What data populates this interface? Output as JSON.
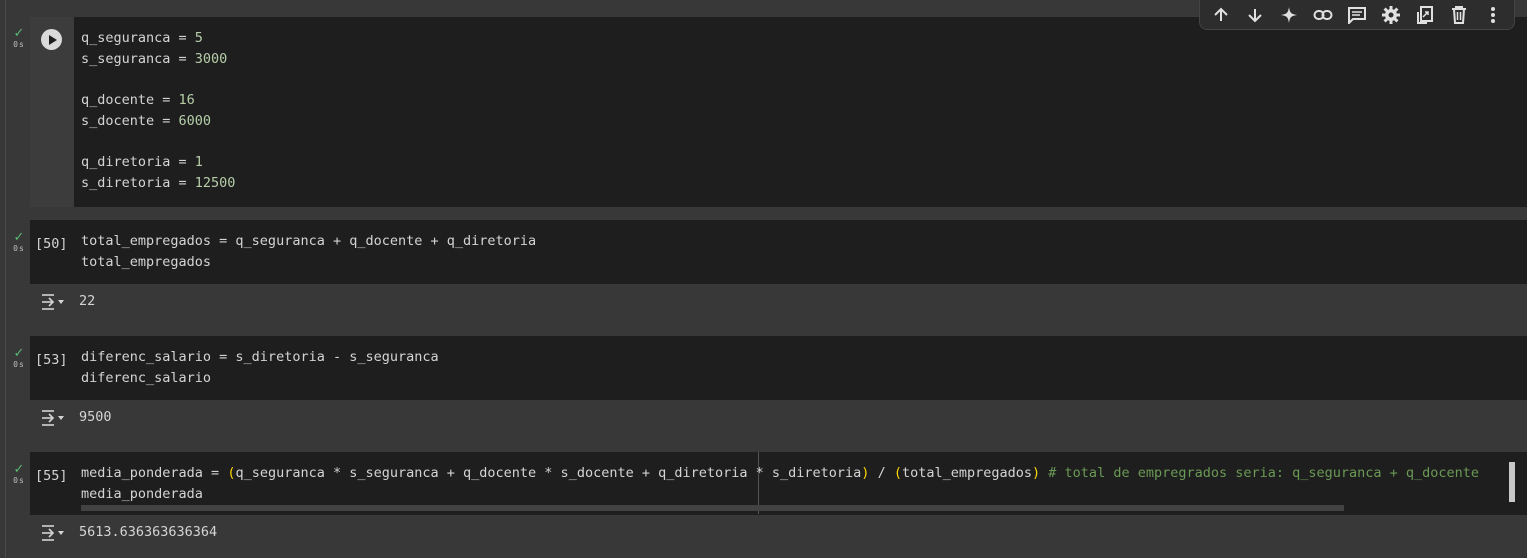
{
  "toolbar": {
    "icons": [
      "arrow-up-icon",
      "arrow-down-icon",
      "sparkle-icon",
      "link-icon",
      "comment-icon",
      "gear-icon",
      "mirror-cell-icon",
      "trash-icon",
      "more-vert-icon"
    ]
  },
  "cells": [
    {
      "status": {
        "check": "✓",
        "time": "0s"
      },
      "prompt": "",
      "lines": [
        [
          [
            "q_seguranca = ",
            ""
          ],
          [
            "5",
            "num"
          ]
        ],
        [
          [
            "s_seguranca = ",
            ""
          ],
          [
            "3000",
            "num"
          ]
        ],
        [
          [
            "",
            ""
          ]
        ],
        [
          [
            "q_docente = ",
            ""
          ],
          [
            "16",
            "num"
          ]
        ],
        [
          [
            "s_docente = ",
            ""
          ],
          [
            "6000",
            "num"
          ]
        ],
        [
          [
            "",
            ""
          ]
        ],
        [
          [
            "q_diretoria = ",
            ""
          ],
          [
            "1",
            "num"
          ]
        ],
        [
          [
            "s_diretoria = ",
            ""
          ],
          [
            "12500",
            "num"
          ]
        ]
      ]
    },
    {
      "status": {
        "check": "✓",
        "time": "0s"
      },
      "prompt": "[50]",
      "lines": [
        [
          [
            "total_empregados = q_seguranca + q_docente + q_diretoria",
            ""
          ]
        ],
        [
          [
            "total_empregados",
            ""
          ]
        ]
      ],
      "output": "22"
    },
    {
      "status": {
        "check": "✓",
        "time": "0s"
      },
      "prompt": "[53]",
      "lines": [
        [
          [
            "diferenc_salario = s_diretoria - s_seguranca",
            ""
          ]
        ],
        [
          [
            "diferenc_salario",
            ""
          ]
        ]
      ],
      "output": "9500"
    },
    {
      "status": {
        "check": "✓",
        "time": "0s"
      },
      "prompt": "[55]",
      "lines": [
        [
          [
            "media_ponderada = ",
            ""
          ],
          [
            "(",
            "paren"
          ],
          [
            "q_seguranca * s_seguranca + q_docente * s_docente + q_diretoria * s_diretoria",
            ""
          ],
          [
            ")",
            "paren"
          ],
          [
            " / ",
            ""
          ],
          [
            "(",
            "paren"
          ],
          [
            "total_empregados",
            ""
          ],
          [
            ")",
            "paren"
          ],
          [
            " ",
            ""
          ],
          [
            "# total de empregrados seria: q_seguranca + q_docente",
            ""
          ]
        ],
        [
          [
            "media_ponderada",
            ""
          ]
        ]
      ],
      "output": "5613.636363636364"
    }
  ]
}
